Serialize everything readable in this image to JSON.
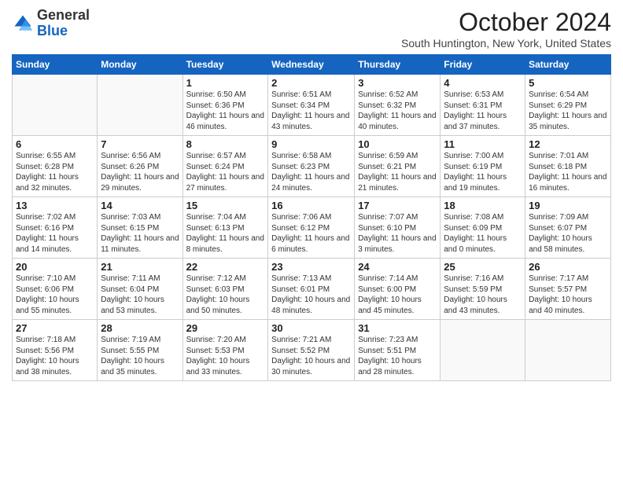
{
  "header": {
    "logo_general": "General",
    "logo_blue": "Blue",
    "month_title": "October 2024",
    "location": "South Huntington, New York, United States"
  },
  "days_of_week": [
    "Sunday",
    "Monday",
    "Tuesday",
    "Wednesday",
    "Thursday",
    "Friday",
    "Saturday"
  ],
  "weeks": [
    [
      {
        "day": "",
        "info": ""
      },
      {
        "day": "",
        "info": ""
      },
      {
        "day": "1",
        "info": "Sunrise: 6:50 AM\nSunset: 6:36 PM\nDaylight: 11 hours and 46 minutes."
      },
      {
        "day": "2",
        "info": "Sunrise: 6:51 AM\nSunset: 6:34 PM\nDaylight: 11 hours and 43 minutes."
      },
      {
        "day": "3",
        "info": "Sunrise: 6:52 AM\nSunset: 6:32 PM\nDaylight: 11 hours and 40 minutes."
      },
      {
        "day": "4",
        "info": "Sunrise: 6:53 AM\nSunset: 6:31 PM\nDaylight: 11 hours and 37 minutes."
      },
      {
        "day": "5",
        "info": "Sunrise: 6:54 AM\nSunset: 6:29 PM\nDaylight: 11 hours and 35 minutes."
      }
    ],
    [
      {
        "day": "6",
        "info": "Sunrise: 6:55 AM\nSunset: 6:28 PM\nDaylight: 11 hours and 32 minutes."
      },
      {
        "day": "7",
        "info": "Sunrise: 6:56 AM\nSunset: 6:26 PM\nDaylight: 11 hours and 29 minutes."
      },
      {
        "day": "8",
        "info": "Sunrise: 6:57 AM\nSunset: 6:24 PM\nDaylight: 11 hours and 27 minutes."
      },
      {
        "day": "9",
        "info": "Sunrise: 6:58 AM\nSunset: 6:23 PM\nDaylight: 11 hours and 24 minutes."
      },
      {
        "day": "10",
        "info": "Sunrise: 6:59 AM\nSunset: 6:21 PM\nDaylight: 11 hours and 21 minutes."
      },
      {
        "day": "11",
        "info": "Sunrise: 7:00 AM\nSunset: 6:19 PM\nDaylight: 11 hours and 19 minutes."
      },
      {
        "day": "12",
        "info": "Sunrise: 7:01 AM\nSunset: 6:18 PM\nDaylight: 11 hours and 16 minutes."
      }
    ],
    [
      {
        "day": "13",
        "info": "Sunrise: 7:02 AM\nSunset: 6:16 PM\nDaylight: 11 hours and 14 minutes."
      },
      {
        "day": "14",
        "info": "Sunrise: 7:03 AM\nSunset: 6:15 PM\nDaylight: 11 hours and 11 minutes."
      },
      {
        "day": "15",
        "info": "Sunrise: 7:04 AM\nSunset: 6:13 PM\nDaylight: 11 hours and 8 minutes."
      },
      {
        "day": "16",
        "info": "Sunrise: 7:06 AM\nSunset: 6:12 PM\nDaylight: 11 hours and 6 minutes."
      },
      {
        "day": "17",
        "info": "Sunrise: 7:07 AM\nSunset: 6:10 PM\nDaylight: 11 hours and 3 minutes."
      },
      {
        "day": "18",
        "info": "Sunrise: 7:08 AM\nSunset: 6:09 PM\nDaylight: 11 hours and 0 minutes."
      },
      {
        "day": "19",
        "info": "Sunrise: 7:09 AM\nSunset: 6:07 PM\nDaylight: 10 hours and 58 minutes."
      }
    ],
    [
      {
        "day": "20",
        "info": "Sunrise: 7:10 AM\nSunset: 6:06 PM\nDaylight: 10 hours and 55 minutes."
      },
      {
        "day": "21",
        "info": "Sunrise: 7:11 AM\nSunset: 6:04 PM\nDaylight: 10 hours and 53 minutes."
      },
      {
        "day": "22",
        "info": "Sunrise: 7:12 AM\nSunset: 6:03 PM\nDaylight: 10 hours and 50 minutes."
      },
      {
        "day": "23",
        "info": "Sunrise: 7:13 AM\nSunset: 6:01 PM\nDaylight: 10 hours and 48 minutes."
      },
      {
        "day": "24",
        "info": "Sunrise: 7:14 AM\nSunset: 6:00 PM\nDaylight: 10 hours and 45 minutes."
      },
      {
        "day": "25",
        "info": "Sunrise: 7:16 AM\nSunset: 5:59 PM\nDaylight: 10 hours and 43 minutes."
      },
      {
        "day": "26",
        "info": "Sunrise: 7:17 AM\nSunset: 5:57 PM\nDaylight: 10 hours and 40 minutes."
      }
    ],
    [
      {
        "day": "27",
        "info": "Sunrise: 7:18 AM\nSunset: 5:56 PM\nDaylight: 10 hours and 38 minutes."
      },
      {
        "day": "28",
        "info": "Sunrise: 7:19 AM\nSunset: 5:55 PM\nDaylight: 10 hours and 35 minutes."
      },
      {
        "day": "29",
        "info": "Sunrise: 7:20 AM\nSunset: 5:53 PM\nDaylight: 10 hours and 33 minutes."
      },
      {
        "day": "30",
        "info": "Sunrise: 7:21 AM\nSunset: 5:52 PM\nDaylight: 10 hours and 30 minutes."
      },
      {
        "day": "31",
        "info": "Sunrise: 7:23 AM\nSunset: 5:51 PM\nDaylight: 10 hours and 28 minutes."
      },
      {
        "day": "",
        "info": ""
      },
      {
        "day": "",
        "info": ""
      }
    ]
  ]
}
